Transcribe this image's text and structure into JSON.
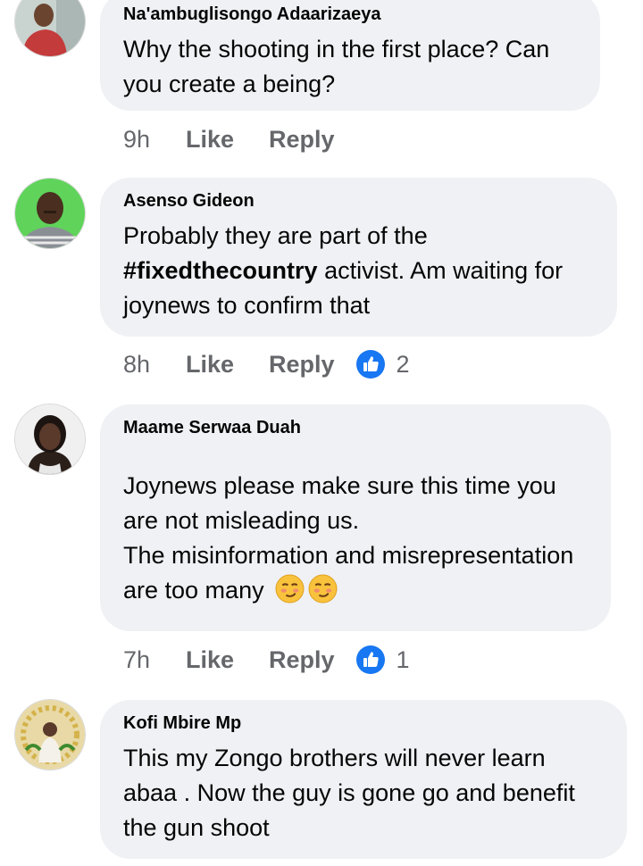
{
  "comments": [
    {
      "author": "Na'ambuglisongo Adaarizaeya",
      "text": "Why the shooting in the first place? Can you create a being?",
      "time": "9h",
      "like_label": "Like",
      "reply_label": "Reply"
    },
    {
      "author": "Asenso Gideon",
      "text_before": "Probably they are part of the",
      "hashtag": "#fixedthecountry",
      "text_after": "activist. Am waiting for joynews to confirm that",
      "time": "8h",
      "like_label": "Like",
      "reply_label": "Reply",
      "reaction_icon": "like-reaction-icon",
      "reaction_count": "2"
    },
    {
      "author": "Maame Serwaa Duah",
      "text": "Joynews please make sure this time you are not misleading us.\nThe misinformation and misrepresentation are too many",
      "emojis": [
        "smirking-face-emoji",
        "smirking-face-emoji"
      ],
      "time": "7h",
      "like_label": "Like",
      "reply_label": "Reply",
      "reaction_icon": "like-reaction-icon",
      "reaction_count": "1"
    },
    {
      "author": "Kofi Mbire Mp",
      "text": "This my Zongo brothers will never learn abaa . Now the guy is gone go and benefit the gun shoot"
    }
  ],
  "colors": {
    "bubble": "#eff1f4",
    "meta_text": "#65676b",
    "like_blue": "#1877f2"
  }
}
